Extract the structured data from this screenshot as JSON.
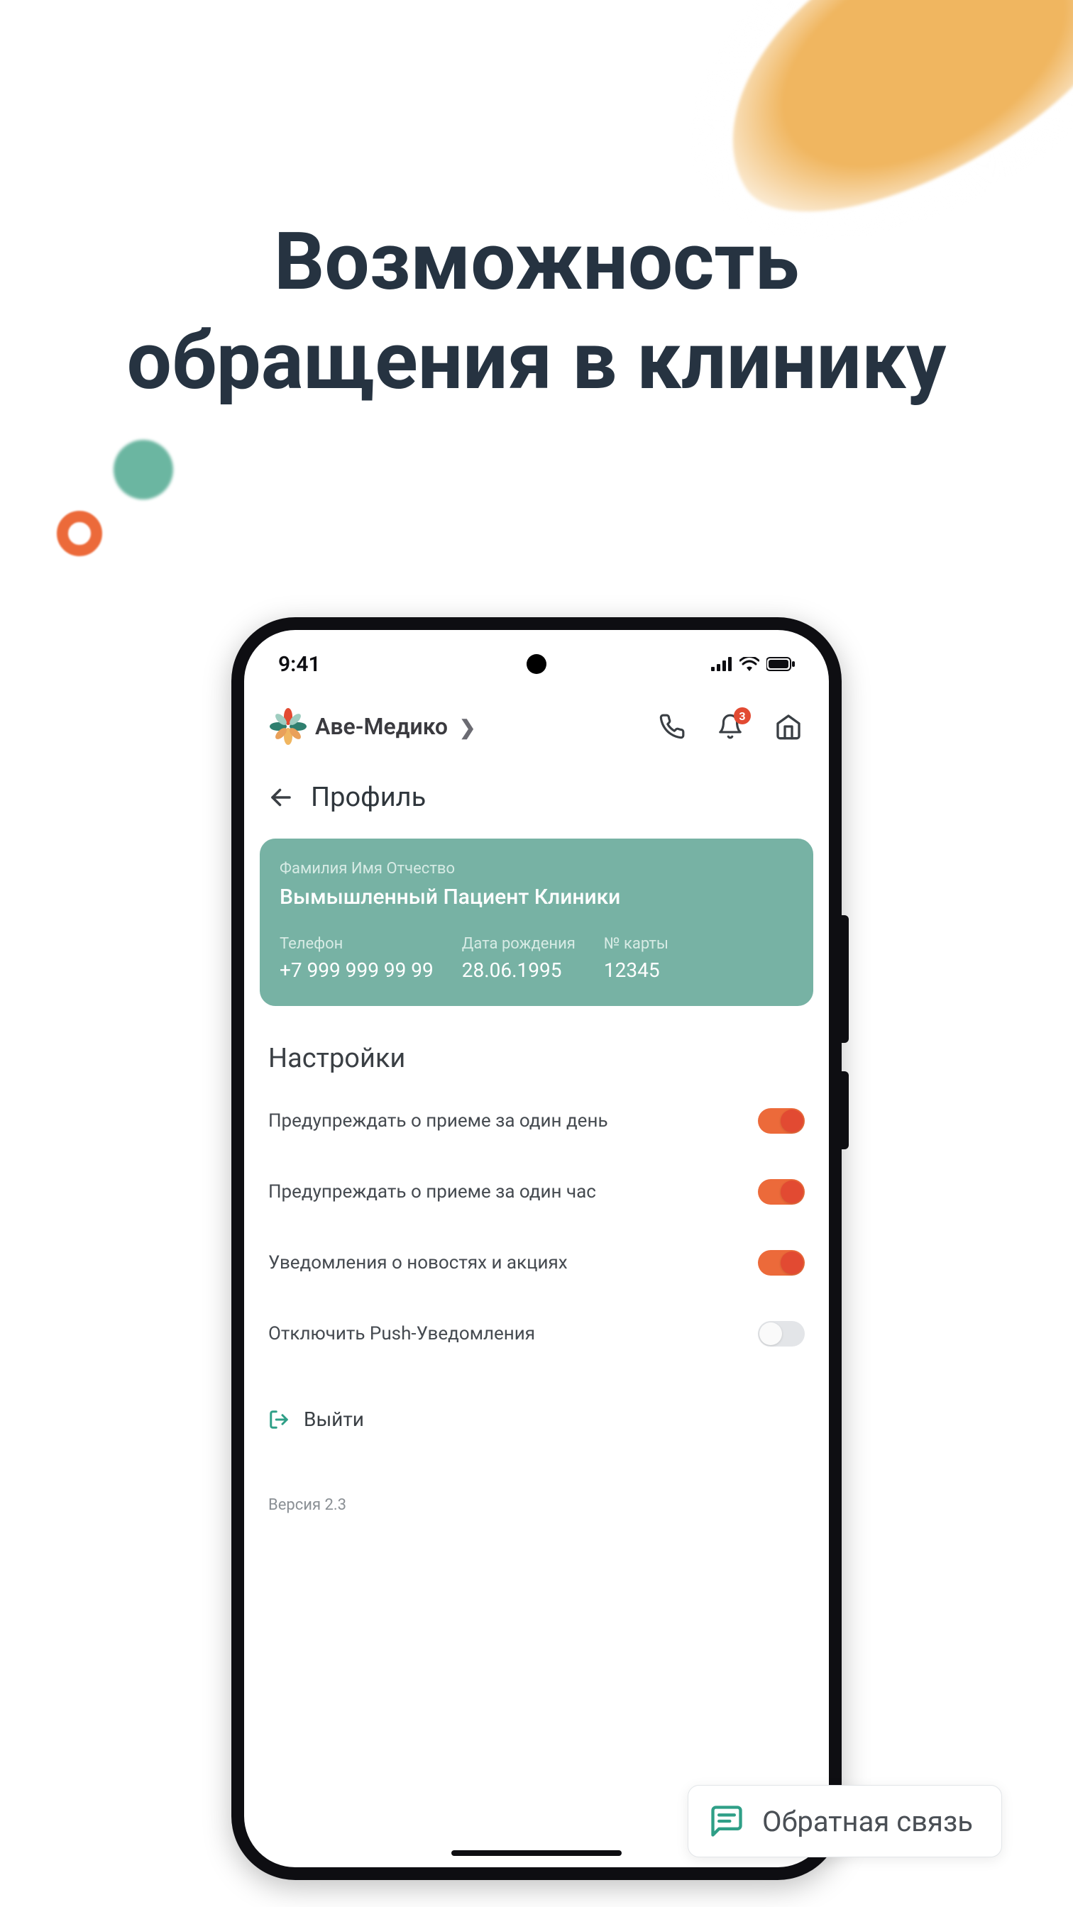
{
  "hero": {
    "line1": "Возможность",
    "line2": "обращения в клинику"
  },
  "status_bar": {
    "time": "9:41"
  },
  "header": {
    "brand_name": "Аве-Медико",
    "notification_count": "3"
  },
  "page": {
    "title": "Профиль"
  },
  "profile_card": {
    "name_label": "Фамилия Имя Отчество",
    "name_value": "Вымышленный Пациент Клиники",
    "phone_label": "Телефон",
    "phone_value": "+7 999 999 99 99",
    "dob_label": "Дата рождения",
    "dob_value": "28.06.1995",
    "card_label": "№ карты",
    "card_value": "12345"
  },
  "settings": {
    "section_title": "Настройки",
    "items": [
      {
        "label": "Предупреждать о приеме за один день",
        "on": true
      },
      {
        "label": "Предупреждать о приеме за один час",
        "on": true
      },
      {
        "label": "Уведомления о новостях и акциях",
        "on": true
      },
      {
        "label": "Отключить Push-Уведомления",
        "on": false
      }
    ]
  },
  "logout_label": "Выйти",
  "version_label": "Версия 2.3",
  "feedback_label": "Обратная связь",
  "colors": {
    "accent_orange": "#ec6a3a",
    "accent_teal": "#77b2a4",
    "text_dark": "#263341"
  }
}
